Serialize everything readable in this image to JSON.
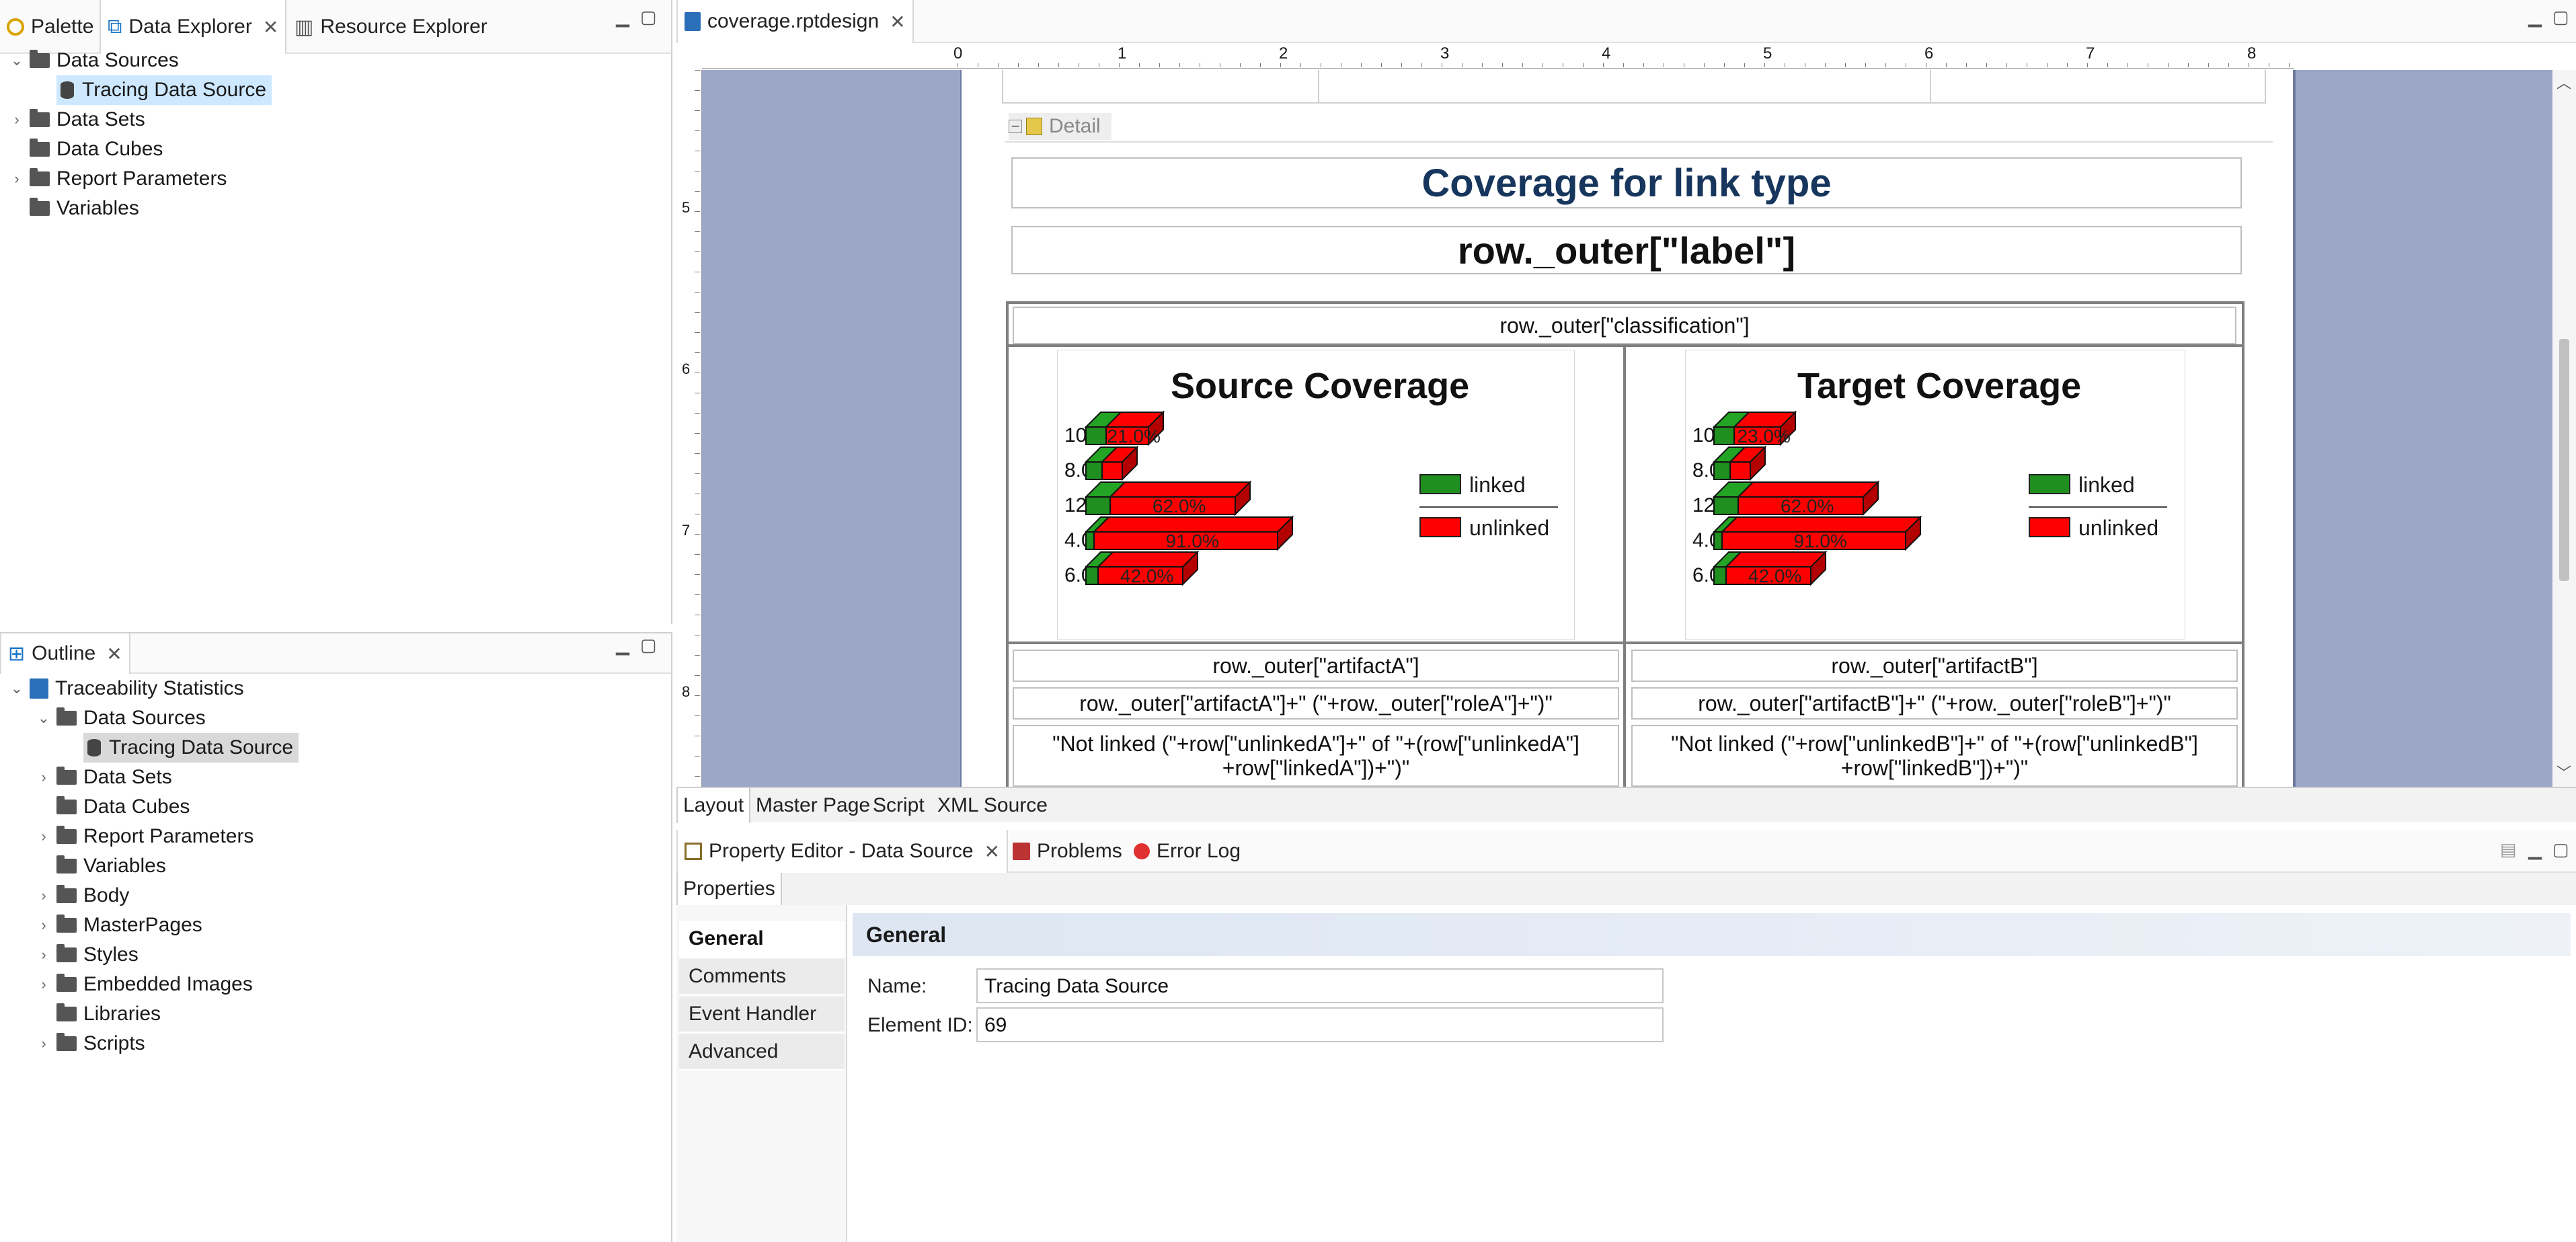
{
  "top_left_panel": {
    "tabs": [
      {
        "label": "Palette"
      },
      {
        "label": "Data Explorer",
        "active": true
      },
      {
        "label": "Resource Explorer"
      }
    ],
    "tree": [
      {
        "label": "Data Sources",
        "expanded": true,
        "level": 0
      },
      {
        "label": "Tracing Data Source",
        "level": 1,
        "selected": true
      },
      {
        "label": "Data Sets",
        "level": 0
      },
      {
        "label": "Data Cubes",
        "level": 0
      },
      {
        "label": "Report Parameters",
        "level": 0
      },
      {
        "label": "Variables",
        "level": 0
      }
    ]
  },
  "outline_panel": {
    "tab_label": "Outline",
    "root": "Traceability Statistics",
    "items": [
      {
        "label": "Data Sources",
        "level": 1,
        "expanded": true
      },
      {
        "label": "Tracing Data Source",
        "level": 2,
        "selected": true
      },
      {
        "label": "Data Sets",
        "level": 1
      },
      {
        "label": "Data Cubes",
        "level": 1
      },
      {
        "label": "Report Parameters",
        "level": 1
      },
      {
        "label": "Variables",
        "level": 1
      },
      {
        "label": "Body",
        "level": 1
      },
      {
        "label": "MasterPages",
        "level": 1
      },
      {
        "label": "Styles",
        "level": 1
      },
      {
        "label": "Embedded Images",
        "level": 1
      },
      {
        "label": "Libraries",
        "level": 1
      },
      {
        "label": "Scripts",
        "level": 1
      }
    ]
  },
  "editor": {
    "tab_label": "coverage.rptdesign",
    "ruler_marks": [
      "0",
      "1",
      "2",
      "3",
      "4",
      "5",
      "6",
      "7",
      "8"
    ],
    "ruler_v_marks": [
      "5",
      "6",
      "7",
      "8"
    ],
    "detail_label": "Detail",
    "title": "Coverage for link type",
    "row_label": "row._outer[\"label\"]",
    "classification": "row._outer[\"classification\"]",
    "source_chart_title": "Source Coverage",
    "target_chart_title": "Target Coverage",
    "cells": {
      "artifact_a": "row._outer[\"artifactA\"]",
      "artifact_b": "row._outer[\"artifactB\"]",
      "role_a": "row._outer[\"artifactA\"]+\" (\"+row._outer[\"roleA\"]+\")\"",
      "role_b": "row._outer[\"artifactB\"]+\" (\"+row._outer[\"roleB\"]+\")\"",
      "not_linked_a_1": "\"Not linked (\"+row[\"unlinkedA\"]+\" of \"+(row[\"unlinkedA\"]",
      "not_linked_a_2": "+row[\"linkedA\"])+\")\"",
      "not_linked_b_1": "\"Not linked (\"+row[\"unlinkedB\"]+\" of \"+(row[\"unlinkedB\"]",
      "not_linked_b_2": "+row[\"linkedB\"])+\")\""
    },
    "bottom_tabs": [
      "Layout",
      "Master Page",
      "Script",
      "XML Source"
    ]
  },
  "chart_data": [
    {
      "type": "bar",
      "orientation": "horizontal",
      "stacked": true,
      "title": "Source Coverage",
      "categories": [
        "10.0%",
        "8.0%",
        "12.0%",
        "4.0%",
        "6.0%"
      ],
      "series": [
        {
          "name": "linked",
          "color": "#1f8f1f",
          "values": [
            10.0,
            8.0,
            12.0,
            4.0,
            6.0
          ]
        },
        {
          "name": "unlinked",
          "color": "#ff0000",
          "values": [
            21.0,
            10.0,
            62.0,
            91.0,
            42.0
          ],
          "labels": [
            "21.0%",
            "",
            "62.0%",
            "91.0%",
            "42.0%"
          ]
        }
      ],
      "legend": "right"
    },
    {
      "type": "bar",
      "orientation": "horizontal",
      "stacked": true,
      "title": "Target Coverage",
      "categories": [
        "10.0%",
        "8.0%",
        "12.0%",
        "4.0%",
        "6.0%"
      ],
      "series": [
        {
          "name": "linked",
          "color": "#1f8f1f",
          "values": [
            10.0,
            8.0,
            12.0,
            4.0,
            6.0
          ]
        },
        {
          "name": "unlinked",
          "color": "#ff0000",
          "values": [
            23.0,
            10.0,
            62.0,
            91.0,
            42.0
          ],
          "labels": [
            "23.0%",
            "",
            "62.0%",
            "91.0%",
            "42.0%"
          ]
        }
      ],
      "legend": "right"
    }
  ],
  "property_editor": {
    "tabs": [
      "Property Editor - Data Source",
      "Problems",
      "Error Log"
    ],
    "properties_tab": "Properties",
    "side_items": [
      "General",
      "Comments",
      "Event Handler",
      "Advanced"
    ],
    "section_title": "General",
    "name_label": "Name:",
    "name_value": "Tracing Data Source",
    "element_id_label": "Element ID:",
    "element_id_value": "69"
  }
}
